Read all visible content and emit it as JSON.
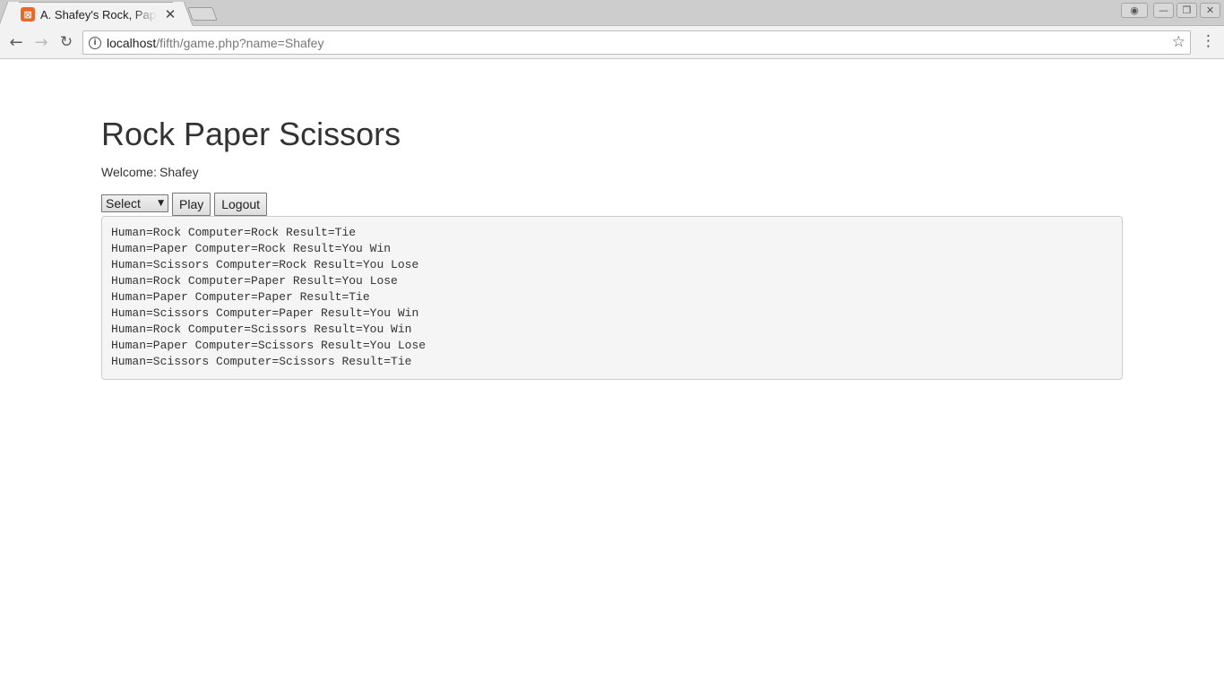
{
  "browser": {
    "tab_title": "A. Shafey's Rock, Paper Scissors",
    "favicon_glyph": "⊠",
    "url_host": "localhost",
    "url_path": "/fifth/game.php?name=Shafey"
  },
  "page": {
    "heading": "Rock Paper Scissors",
    "welcome_label": "Welcome:",
    "welcome_name": "Shafey",
    "select_value": "Select",
    "play_label": "Play",
    "logout_label": "Logout",
    "results": [
      "Human=Rock Computer=Rock Result=Tie",
      "Human=Paper Computer=Rock Result=You Win",
      "Human=Scissors Computer=Rock Result=You Lose",
      "Human=Rock Computer=Paper Result=You Lose",
      "Human=Paper Computer=Paper Result=Tie",
      "Human=Scissors Computer=Paper Result=You Win",
      "Human=Rock Computer=Scissors Result=You Win",
      "Human=Paper Computer=Scissors Result=You Lose",
      "Human=Scissors Computer=Scissors Result=Tie"
    ]
  },
  "icons": {
    "back": "arrow-left-icon",
    "forward": "arrow-right-icon",
    "reload": "reload-icon",
    "info": "info-icon",
    "star": "star-icon",
    "menu": "kebab-menu-icon",
    "tab_close": "close-icon"
  },
  "colors": {
    "favicon": "#e8692b",
    "results_bg": "#f5f5f5",
    "text": "#333333"
  }
}
